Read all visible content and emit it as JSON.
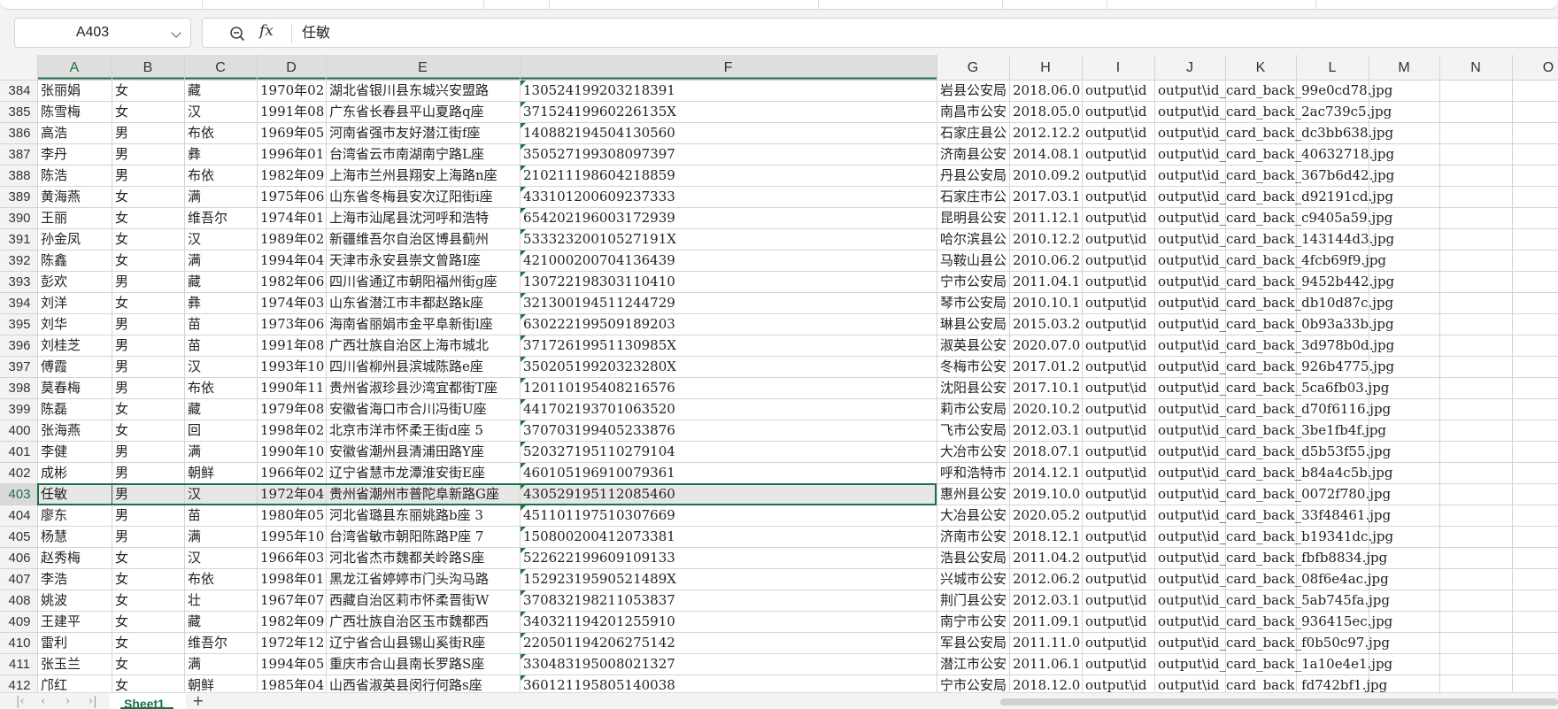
{
  "name_box": {
    "value": "A403"
  },
  "formula_bar": {
    "content": "任敏"
  },
  "icons": {
    "zoom": "zoom-icon",
    "function": "fx-icon",
    "dropdown": "chevron-down-icon"
  },
  "columns": [
    "A",
    "B",
    "C",
    "D",
    "E",
    "F",
    "G",
    "H",
    "I",
    "J",
    "K",
    "L",
    "M",
    "N",
    "O"
  ],
  "selected_row": 403,
  "selected_column": "A",
  "rows": [
    {
      "n": 384,
      "a": "张丽娟",
      "b": "女",
      "c": "藏",
      "d": "1970年02",
      "e": "湖北省银川县东城兴安盟路",
      "f": "130524199203218391",
      "g": "岩县公安局",
      "h": "2018.06.0",
      "i": "output\\id",
      "j": "output\\id_card_back_99e0cd78.jpg"
    },
    {
      "n": 385,
      "a": "陈雪梅",
      "b": "女",
      "c": "汉",
      "d": "1991年08",
      "e": "广东省长春县平山夏路q座",
      "f": "37152419960226135X",
      "g": "南昌市公安",
      "h": "2018.05.0",
      "i": "output\\id",
      "j": "output\\id_card_back_2ac739c5.jpg"
    },
    {
      "n": 386,
      "a": "高浩",
      "b": "男",
      "c": "布依",
      "d": "1969年05",
      "e": "河南省强市友好潜江街f座",
      "f": "140882194504130560",
      "g": "石家庄县公",
      "h": "2012.12.2",
      "i": "output\\id",
      "j": "output\\id_card_back_dc3bb638.jpg"
    },
    {
      "n": 387,
      "a": "李丹",
      "b": "男",
      "c": "彝",
      "d": "1996年01",
      "e": "台湾省云市南湖南宁路L座",
      "f": "350527199308097397",
      "g": "济南县公安",
      "h": "2014.08.1",
      "i": "output\\id",
      "j": "output\\id_card_back_40632718.jpg"
    },
    {
      "n": 388,
      "a": "陈浩",
      "b": "男",
      "c": "布依",
      "d": "1982年09",
      "e": "上海市兰州县翔安上海路n座",
      "f": "210211198604218859",
      "g": "丹县公安局",
      "h": "2010.09.2",
      "i": "output\\id",
      "j": "output\\id_card_back_367b6d42.jpg"
    },
    {
      "n": 389,
      "a": "黄海燕",
      "b": "女",
      "c": "满",
      "d": "1975年06",
      "e": "山东省冬梅县安次辽阳街i座",
      "f": "433101200609237333",
      "g": "石家庄市公",
      "h": "2017.03.1",
      "i": "output\\id",
      "j": "output\\id_card_back_d92191cd.jpg"
    },
    {
      "n": 390,
      "a": "王丽",
      "b": "女",
      "c": "维吾尔",
      "d": "1974年01",
      "e": "上海市汕尾县沈河呼和浩特",
      "f": "654202196003172939",
      "g": "昆明县公安",
      "h": "2011.12.1",
      "i": "output\\id",
      "j": "output\\id_card_back_c9405a59.jpg"
    },
    {
      "n": 391,
      "a": "孙金凤",
      "b": "女",
      "c": "汉",
      "d": "1989年02",
      "e": "新疆维吾尔自治区博县蓟州",
      "f": "53332320010527191X",
      "g": "哈尔滨县公",
      "h": "2010.12.2",
      "i": "output\\id",
      "j": "output\\id_card_back_143144d3.jpg"
    },
    {
      "n": 392,
      "a": "陈鑫",
      "b": "女",
      "c": "满",
      "d": "1994年04",
      "e": "天津市永安县崇文曾路I座",
      "f": "421000200704136439",
      "g": "马鞍山县公",
      "h": "2010.06.2",
      "i": "output\\id",
      "j": "output\\id_card_back_4fcb69f9.jpg"
    },
    {
      "n": 393,
      "a": "彭欢",
      "b": "男",
      "c": "藏",
      "d": "1982年06",
      "e": "四川省通辽市朝阳福州街g座",
      "f": "130722198303110410",
      "g": "宁市公安局",
      "h": "2011.04.1",
      "i": "output\\id",
      "j": "output\\id_card_back_9452b442.jpg"
    },
    {
      "n": 394,
      "a": "刘洋",
      "b": "女",
      "c": "彝",
      "d": "1974年03",
      "e": "山东省潜江市丰都赵路k座",
      "f": "321300194511244729",
      "g": "琴市公安局",
      "h": "2010.10.1",
      "i": "output\\id",
      "j": "output\\id_card_back_db10d87c.jpg"
    },
    {
      "n": 395,
      "a": "刘华",
      "b": "男",
      "c": "苗",
      "d": "1973年06",
      "e": "海南省丽娟市金平阜新街l座",
      "f": "630222199509189203",
      "g": "琳县公安局",
      "h": "2015.03.2",
      "i": "output\\id",
      "j": "output\\id_card_back_0b93a33b.jpg"
    },
    {
      "n": 396,
      "a": "刘桂芝",
      "b": "男",
      "c": "苗",
      "d": "1991年08",
      "e": "广西壮族自治区上海市城北",
      "f": "37172619951130985X",
      "g": "淑英县公安",
      "h": "2020.07.0",
      "i": "output\\id",
      "j": "output\\id_card_back_3d978b0d.jpg"
    },
    {
      "n": 397,
      "a": "傅霞",
      "b": "男",
      "c": "汉",
      "d": "1993年10",
      "e": "四川省柳州县滨城陈路e座",
      "f": "35020519920323280X",
      "g": "冬梅市公安",
      "h": "2017.01.2",
      "i": "output\\id",
      "j": "output\\id_card_back_926b4775.jpg"
    },
    {
      "n": 398,
      "a": "莫春梅",
      "b": "男",
      "c": "布依",
      "d": "1990年11",
      "e": "贵州省淑珍县沙湾宜都街T座",
      "f": "120110195408216576",
      "g": "沈阳县公安",
      "h": "2017.10.1",
      "i": "output\\id",
      "j": "output\\id_card_back_5ca6fb03.jpg"
    },
    {
      "n": 399,
      "a": "陈磊",
      "b": "女",
      "c": "藏",
      "d": "1979年08",
      "e": "安徽省海口市合川冯街U座",
      "f": "441702193701063520",
      "g": "莉市公安局",
      "h": "2020.10.2",
      "i": "output\\id",
      "j": "output\\id_card_back_d70f6116.jpg"
    },
    {
      "n": 400,
      "a": "张海燕",
      "b": "女",
      "c": "回",
      "d": "1998年02",
      "e": "北京市洋市怀柔王街d座 5",
      "f": "370703199405233876",
      "g": "飞市公安局",
      "h": "2012.03.1",
      "i": "output\\id",
      "j": "output\\id_card_back_3be1fb4f.jpg"
    },
    {
      "n": 401,
      "a": "李健",
      "b": "男",
      "c": "满",
      "d": "1990年10",
      "e": "安徽省潮州县清浦田路Y座",
      "f": "520327195110279104",
      "g": "大冶市公安",
      "h": "2018.07.1",
      "i": "output\\id",
      "j": "output\\id_card_back_d5b53f55.jpg"
    },
    {
      "n": 402,
      "a": "成彬",
      "b": "男",
      "c": "朝鲜",
      "d": "1966年02",
      "e": "辽宁省慧市龙潭淮安街E座",
      "f": "460105196910079361",
      "g": "呼和浩特市",
      "h": "2014.12.1",
      "i": "output\\id",
      "j": "output\\id_card_back_b84a4c5b.jpg"
    },
    {
      "n": 403,
      "a": "任敏",
      "b": "男",
      "c": "汉",
      "d": "1972年04",
      "e": "贵州省潮州市普陀阜新路G座",
      "f": "430529195112085460",
      "g": "惠州县公安",
      "h": "2019.10.0",
      "i": "output\\id",
      "j": "output\\id_card_back_0072f780.jpg"
    },
    {
      "n": 404,
      "a": "廖东",
      "b": "男",
      "c": "苗",
      "d": "1980年05",
      "e": "河北省璐县东丽姚路b座 3",
      "f": "451101197510307669",
      "g": "大冶县公安",
      "h": "2020.05.2",
      "i": "output\\id",
      "j": "output\\id_card_back_33f48461.jpg"
    },
    {
      "n": 405,
      "a": "杨慧",
      "b": "男",
      "c": "满",
      "d": "1995年10",
      "e": "台湾省敏市朝阳陈路P座 7",
      "f": "150800200412073381",
      "g": "济南市公安",
      "h": "2018.12.1",
      "i": "output\\id",
      "j": "output\\id_card_back_b19341dc.jpg"
    },
    {
      "n": 406,
      "a": "赵秀梅",
      "b": "女",
      "c": "汉",
      "d": "1966年03",
      "e": "河北省杰市魏都关岭路S座",
      "f": "522622199609109133",
      "g": "浩县公安局",
      "h": "2011.04.2",
      "i": "output\\id",
      "j": "output\\id_card_back_fbfb8834.jpg"
    },
    {
      "n": 407,
      "a": "李浩",
      "b": "女",
      "c": "布依",
      "d": "1998年01",
      "e": "黑龙江省婷婷市门头沟马路",
      "f": "15292319590521489X",
      "g": "兴城市公安",
      "h": "2012.06.2",
      "i": "output\\id",
      "j": "output\\id_card_back_08f6e4ac.jpg"
    },
    {
      "n": 408,
      "a": "姚波",
      "b": "女",
      "c": "壮",
      "d": "1967年07",
      "e": "西藏自治区莉市怀柔晋街W",
      "f": "370832198211053837",
      "g": "荆门县公安",
      "h": "2012.03.1",
      "i": "output\\id",
      "j": "output\\id_card_back_5ab745fa.jpg"
    },
    {
      "n": 409,
      "a": "王建平",
      "b": "女",
      "c": "藏",
      "d": "1982年09",
      "e": "广西壮族自治区玉市魏都西",
      "f": "340321194201255910",
      "g": "南宁市公安",
      "h": "2011.09.1",
      "i": "output\\id",
      "j": "output\\id_card_back_936415ec.jpg"
    },
    {
      "n": 410,
      "a": "雷利",
      "b": "女",
      "c": "维吾尔",
      "d": "1972年12",
      "e": "辽宁省合山县锡山奚街R座",
      "f": "220501194206275142",
      "g": "军县公安局",
      "h": "2011.11.0",
      "i": "output\\id",
      "j": "output\\id_card_back_f0b50c97.jpg"
    },
    {
      "n": 411,
      "a": "张玉兰",
      "b": "女",
      "c": "满",
      "d": "1994年05",
      "e": "重庆市合山县南长罗路S座",
      "f": "330483195008021327",
      "g": "潜江市公安",
      "h": "2011.06.1",
      "i": "output\\id",
      "j": "output\\id_card_back_1a10e4e1.jpg"
    },
    {
      "n": 412,
      "a": "邝红",
      "b": "女",
      "c": "朝鲜",
      "d": "1985年04",
      "e": "山西省淑英县闵行何路s座",
      "f": "360121195805140038",
      "g": "宁市公安局",
      "h": "2018.12.0",
      "i": "output\\id",
      "j": "output\\id_card_back_fd742bf1.jpg"
    }
  ],
  "sheet_tabs": {
    "active": "Sheet1",
    "add": "+"
  }
}
